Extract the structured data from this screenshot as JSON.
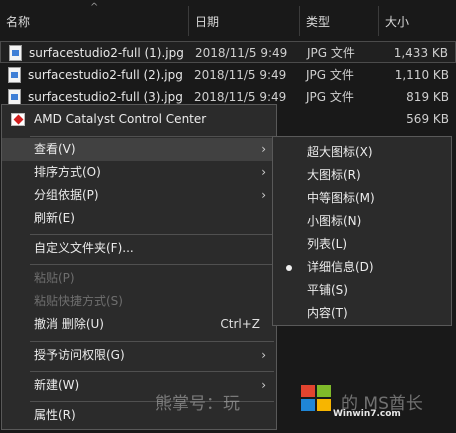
{
  "columns": {
    "name": "名称",
    "date": "日期",
    "type": "类型",
    "size": "大小",
    "sort_arrow": "^"
  },
  "files": [
    {
      "name": "surfacestudio2-full (1).jpg",
      "date": "2018/11/5 9:49",
      "type": "JPG 文件",
      "size": "1,433 KB",
      "icon": "jpg-file-icon"
    },
    {
      "name": "surfacestudio2-full (2).jpg",
      "date": "2018/11/5 9:49",
      "type": "JPG 文件",
      "size": "1,110 KB",
      "icon": "jpg-file-icon"
    },
    {
      "name": "surfacestudio2-full (3).jpg",
      "date": "2018/11/5 9:49",
      "type": "JPG 文件",
      "size": "819 KB",
      "icon": "jpg-file-icon"
    },
    {
      "name": "",
      "date": "",
      "type": "",
      "size": "569 KB",
      "icon": ""
    }
  ],
  "context_menu": {
    "amd": "AMD Catalyst Control Center",
    "view": "查看(V)",
    "sort": "排序方式(O)",
    "group": "分组依据(P)",
    "refresh": "刷新(E)",
    "customize": "自定义文件夹(F)...",
    "paste": "粘贴(P)",
    "paste_shortcut": "粘贴快捷方式(S)",
    "undo": "撤消 删除(U)",
    "undo_shortcut": "Ctrl+Z",
    "grant_access": "授予访问权限(G)",
    "new": "新建(W)",
    "properties": "属性(R)",
    "submenu_arrow": "›"
  },
  "view_submenu": {
    "items": [
      "超大图标(X)",
      "大图标(R)",
      "中等图标(M)",
      "小图标(N)",
      "列表(L)",
      "详细信息(D)",
      "平铺(S)",
      "内容(T)"
    ],
    "selected": "详细信息(D)"
  },
  "watermark": {
    "left_text": "熊掌号：玩",
    "right_text": "的 MS酋长",
    "url": "Winwin7.com"
  },
  "colors": {
    "background": "#191919",
    "menu_bg": "#2b2b2b",
    "menu_highlight": "#414141",
    "menu_border": "#595959",
    "disabled_text": "#6e6e6e"
  }
}
